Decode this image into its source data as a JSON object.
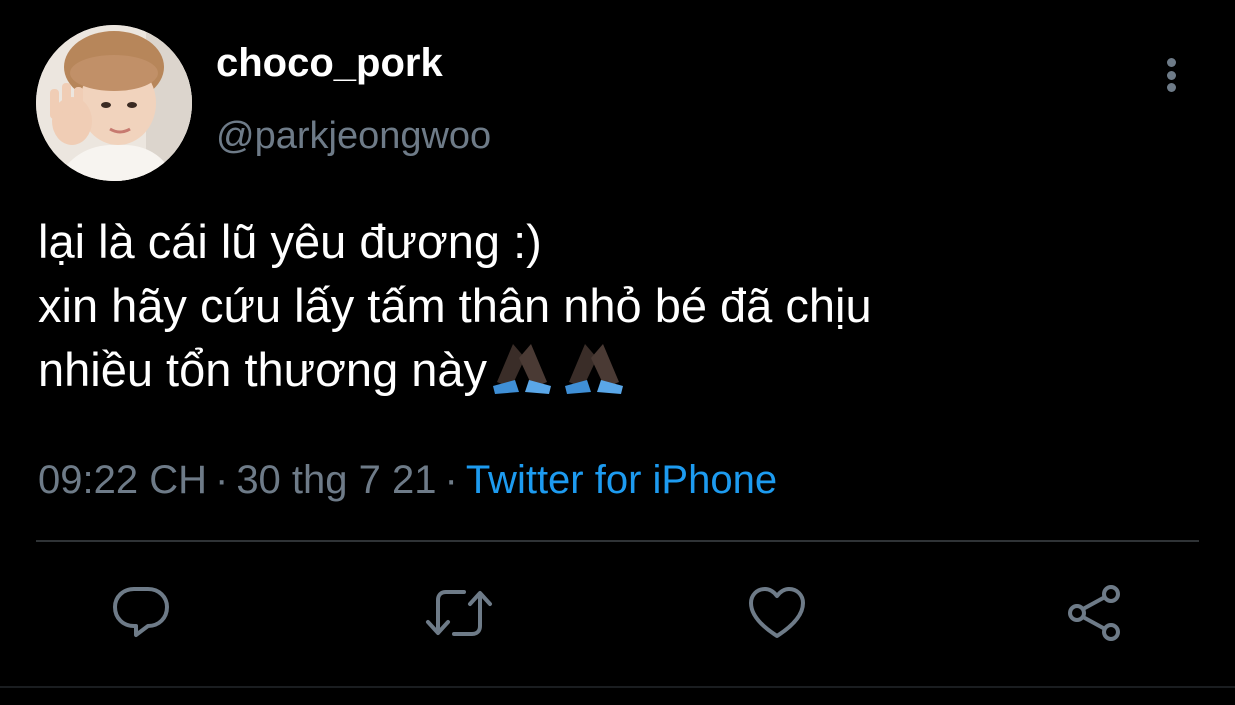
{
  "user": {
    "display_name": "choco_pork",
    "handle": "@parkjeongwoo"
  },
  "tweet": {
    "lines": [
      "lại là cái lũ yêu đương :)",
      "xin hãy cứu lấy tấm thân nhỏ bé đã chịu",
      "nhiều tổn thương này"
    ],
    "emoji": "pray-hands-icon x2"
  },
  "meta": {
    "time": "09:22 CH",
    "separator": "·",
    "date": "30 thg 7 21",
    "source": "Twitter for iPhone"
  },
  "actions": [
    {
      "name": "reply",
      "icon": "reply-icon"
    },
    {
      "name": "retweet",
      "icon": "retweet-icon"
    },
    {
      "name": "like",
      "icon": "heart-icon"
    },
    {
      "name": "share",
      "icon": "share-icon"
    }
  ],
  "colors": {
    "background": "#000000",
    "text": "#ffffff",
    "secondary": "#6e7b88",
    "link": "#1d9bf0",
    "icon": "#6e7b88"
  }
}
